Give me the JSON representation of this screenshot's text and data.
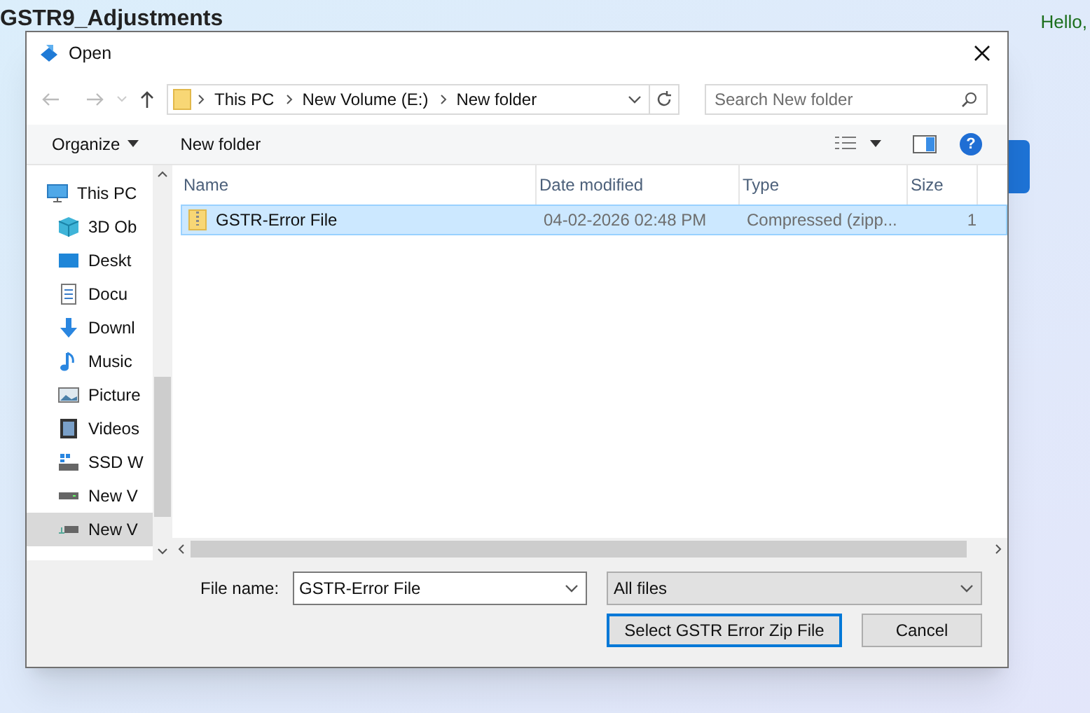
{
  "page": {
    "title": "GSTR9_Adjustments",
    "greeting": "Hello,"
  },
  "dialog": {
    "title": "Open",
    "breadcrumb": [
      "This PC",
      "New Volume (E:)",
      "New folder"
    ],
    "search": {
      "placeholder": "Search New folder"
    },
    "toolbar": {
      "organize": "Organize",
      "new_folder": "New folder"
    },
    "nav": [
      {
        "label": "This PC",
        "selected": false
      },
      {
        "label": "3D Ob",
        "selected": false
      },
      {
        "label": "Deskt",
        "selected": false
      },
      {
        "label": "Docu",
        "selected": false
      },
      {
        "label": "Downl",
        "selected": false
      },
      {
        "label": "Music",
        "selected": false
      },
      {
        "label": "Picture",
        "selected": false
      },
      {
        "label": "Videos",
        "selected": false
      },
      {
        "label": "SSD W",
        "selected": false
      },
      {
        "label": "New V",
        "selected": false
      },
      {
        "label": "New V",
        "selected": true
      }
    ],
    "help": "?",
    "columns": [
      "Name",
      "Date modified",
      "Type",
      "Size"
    ],
    "rows": [
      {
        "name": "GSTR-Error File",
        "date": "04-02-2026 02:48 PM",
        "type": "Compressed (zipp...",
        "size": "1",
        "selected": true
      }
    ],
    "file_name_label": "File name:",
    "file_name": "GSTR-Error File",
    "file_type": "All files",
    "buttons": [
      "Select GSTR Error Zip File",
      "Cancel"
    ]
  }
}
